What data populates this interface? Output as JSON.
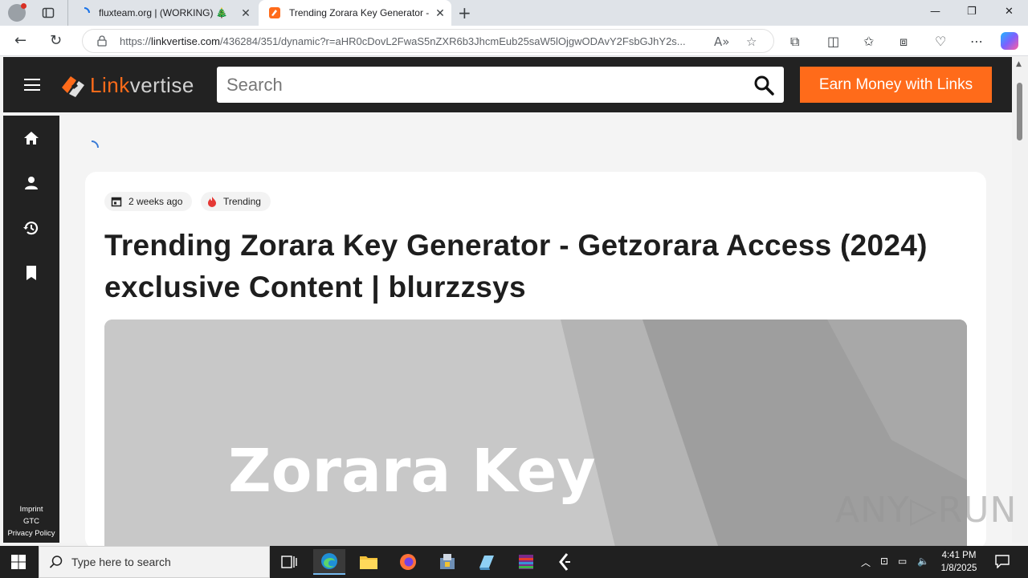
{
  "browser": {
    "tabs": [
      {
        "title": "fluxteam.org | (WORKING) 🎄"
      },
      {
        "title": "Trending Zorara Key Generator - G"
      }
    ],
    "url_prefix": "https://",
    "url_host": "linkvertise.com",
    "url_rest": "/436284/351/dynamic?r=aHR0cDovL2FwaS5nZXR6b3JhcmEub25saW5lOjgwODAvY2FsbGJhY2s..."
  },
  "site": {
    "logo_part1": "Link",
    "logo_part2": "vertise",
    "search_placeholder": "Search",
    "earn_label": "Earn Money with Links",
    "accent": "#ff6b1a"
  },
  "sidebar": {
    "items": [
      {
        "icon": "home-icon"
      },
      {
        "icon": "user-icon"
      },
      {
        "icon": "history-icon"
      },
      {
        "icon": "bookmark-icon"
      }
    ],
    "footer": [
      "Imprint",
      "GTC",
      "Privacy Policy"
    ]
  },
  "article": {
    "date": "2 weeks ago",
    "tag": "Trending",
    "title": "Trending Zorara Key Generator - Getzorara Access (2024) exclusive Content | blurzzsys",
    "hero_text": "Zorara Key"
  },
  "watermark": "ANY▷RUN",
  "taskbar": {
    "search_placeholder": "Type here to search",
    "time": "4:41 PM",
    "date": "1/8/2025"
  }
}
